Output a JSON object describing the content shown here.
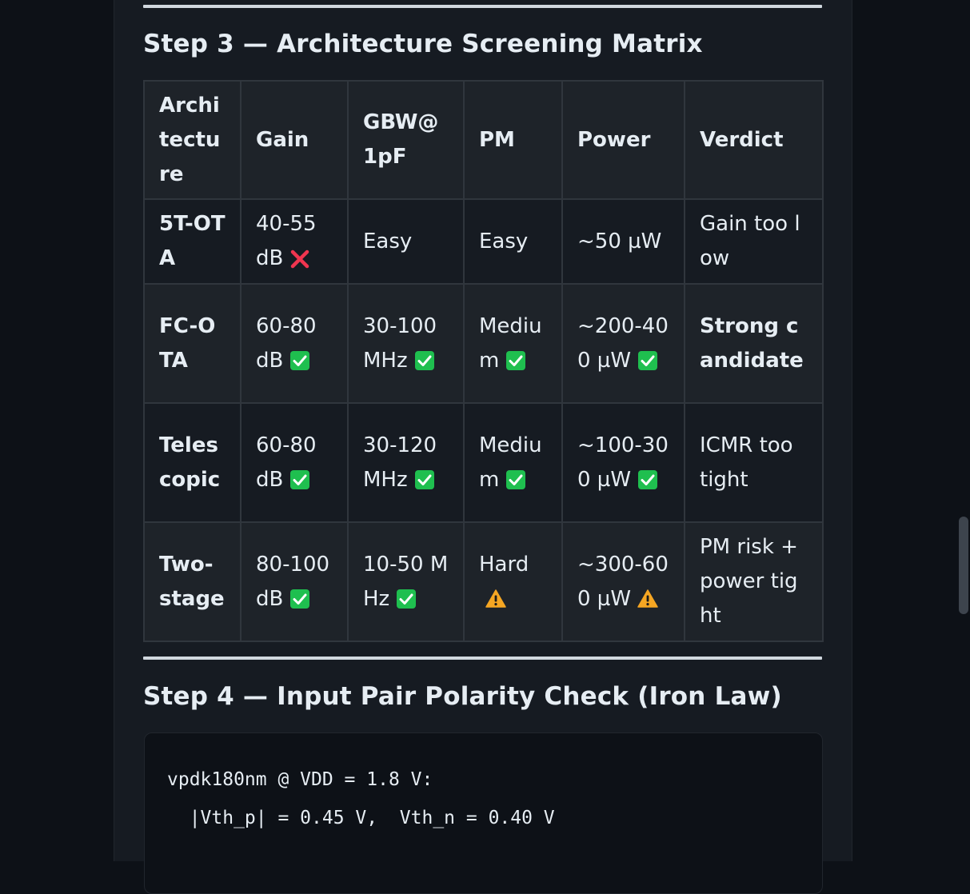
{
  "step3": {
    "title": "Step 3 — Architecture Screening Matrix"
  },
  "table": {
    "headers": [
      "Architecture",
      "Gain",
      "GBW@ 1pF",
      "PM",
      "Power",
      "Verdict"
    ],
    "rows": [
      {
        "arch": "5T-OTA",
        "gain": "40-55 dB",
        "gain_icon": "cross-icon",
        "gbw": "Easy",
        "gbw_icon": "",
        "pm": "Easy",
        "pm_icon": "",
        "power": "~50 µW",
        "power_icon": "",
        "verdict": "Gain too low",
        "verdict_strong": false
      },
      {
        "arch": "FC-OTA",
        "gain": "60-80 dB",
        "gain_icon": "check-icon",
        "gbw": "30-100 MHz",
        "gbw_icon": "check-icon",
        "pm": "Medium",
        "pm_icon": "check-icon",
        "power": "~200-400 µW",
        "power_icon": "check-icon",
        "verdict": "Strong candidate",
        "verdict_strong": true
      },
      {
        "arch": "Telescopic",
        "gain": "60-80 dB",
        "gain_icon": "check-icon",
        "gbw": "30-120 MHz",
        "gbw_icon": "check-icon",
        "pm": "Medium",
        "pm_icon": "check-icon",
        "power": "~100-300 µW",
        "power_icon": "check-icon",
        "verdict": "ICMR too tight",
        "verdict_strong": false
      },
      {
        "arch": "Two-stage",
        "gain": "80-100 dB",
        "gain_icon": "check-icon",
        "gbw": "10-50 MHz",
        "gbw_icon": "check-icon",
        "pm": "Hard",
        "pm_icon": "warning-icon",
        "power": "~300-600 µW",
        "power_icon": "warning-icon",
        "verdict": "PM risk + power tight",
        "verdict_strong": false
      }
    ]
  },
  "step4": {
    "title": "Step 4 — Input Pair Polarity Check (Iron Law)"
  },
  "code": {
    "lines": [
      "vpdk180nm @ VDD = 1.8 V:",
      "  |Vth_p| = 0.45 V,  Vth_n = 0.40 V"
    ]
  },
  "colors": {
    "check": "#1fbf4f",
    "cross": "#f0354f",
    "warning": "#f5a623"
  }
}
